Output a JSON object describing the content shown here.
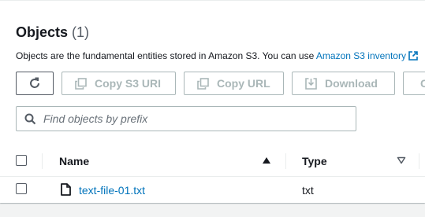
{
  "header": {
    "title": "Objects",
    "count": "(1)",
    "description": "Objects are the fundamental entities stored in Amazon S3. You can use ",
    "description_link": "Amazon S3 inventory"
  },
  "toolbar": {
    "copy_s3_uri_label": "Copy S3 URI",
    "copy_url_label": "Copy URL",
    "download_label": "Download",
    "more_label": "C"
  },
  "search": {
    "placeholder": "Find objects by prefix",
    "value": ""
  },
  "table": {
    "columns": [
      {
        "label": "Name",
        "sort": "ascending"
      },
      {
        "label": "Type",
        "sort": "none"
      }
    ],
    "rows": [
      {
        "name": "text-file-01.txt",
        "type": "txt"
      }
    ]
  },
  "colors": {
    "link": "#0073bb",
    "disabled": "#aab7b8",
    "border": "#aab7b8",
    "text": "#16191f"
  },
  "icons": [
    "refresh-icon",
    "copy-icon",
    "download-icon",
    "search-icon",
    "sort-up-icon",
    "sort-down-icon",
    "file-icon",
    "external-link-icon"
  ]
}
